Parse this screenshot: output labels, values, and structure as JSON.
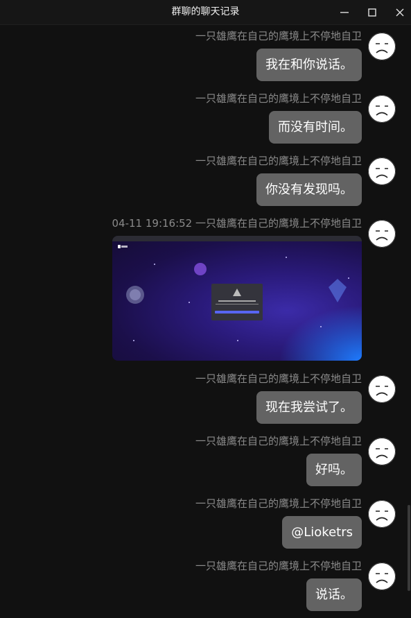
{
  "window": {
    "title": "群聊的聊天记录",
    "icons": [
      "minimize-icon",
      "maximize-icon",
      "close-icon"
    ]
  },
  "messages": [
    {
      "sender": "一只雄鹰在自己的鹰境上不停地自卫",
      "text": "我在和你说话。"
    },
    {
      "sender": "一只雄鹰在自己的鹰境上不停地自卫",
      "text": "而没有时间。"
    },
    {
      "sender": "一只雄鹰在自己的鹰境上不停地自卫",
      "text": "你没有发现吗。"
    },
    {
      "sender": "04-11 19:16:52 一只雄鹰在自己的鹰境上不停地自卫",
      "image": "discord-login-screenshot"
    },
    {
      "sender": "一只雄鹰在自己的鹰境上不停地自卫",
      "text": "现在我尝试了。"
    },
    {
      "sender": "一只雄鹰在自己的鹰境上不停地自卫",
      "text": "好吗。"
    },
    {
      "sender": "一只雄鹰在自己的鹰境上不停地自卫",
      "text": "@Lioketrs"
    },
    {
      "sender": "一只雄鹰在自己的鹰境上不停地自卫",
      "text": "说话。"
    }
  ],
  "colors": {
    "background": "#111111",
    "bubble": "#636363",
    "sender_text": "#8a8a8a",
    "discord_accent": "#5865f2"
  }
}
